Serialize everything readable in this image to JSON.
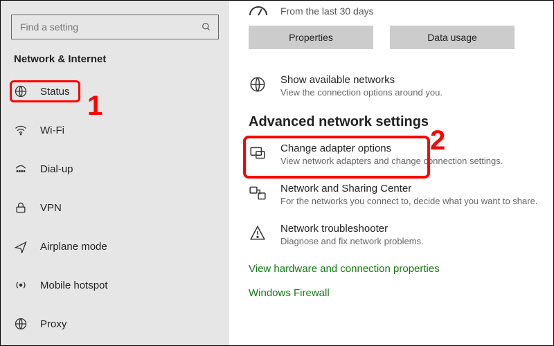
{
  "sidebar": {
    "search": {
      "placeholder": "Find a setting"
    },
    "category": "Network & Internet",
    "items": [
      {
        "label": "Status",
        "icon": "status"
      },
      {
        "label": "Wi-Fi",
        "icon": "wifi"
      },
      {
        "label": "Dial-up",
        "icon": "dialup"
      },
      {
        "label": "VPN",
        "icon": "vpn"
      },
      {
        "label": "Airplane mode",
        "icon": "airplane"
      },
      {
        "label": "Mobile hotspot",
        "icon": "hotspot"
      },
      {
        "label": "Proxy",
        "icon": "proxy"
      }
    ]
  },
  "main": {
    "meter_caption": "From the last 30 days",
    "buttons": {
      "properties": "Properties",
      "data_usage": "Data usage"
    },
    "available": {
      "title": "Show available networks",
      "sub": "View the connection options around you."
    },
    "section": "Advanced network settings",
    "adapter": {
      "title": "Change adapter options",
      "sub": "View network adapters and change connection settings."
    },
    "sharing": {
      "title": "Network and Sharing Center",
      "sub": "For the networks you connect to, decide what you want to share."
    },
    "trouble": {
      "title": "Network troubleshooter",
      "sub": "Diagnose and fix network problems."
    },
    "link_hw": "View hardware and connection properties",
    "link_fw": "Windows Firewall"
  },
  "annotations": {
    "one": "1",
    "two": "2"
  }
}
